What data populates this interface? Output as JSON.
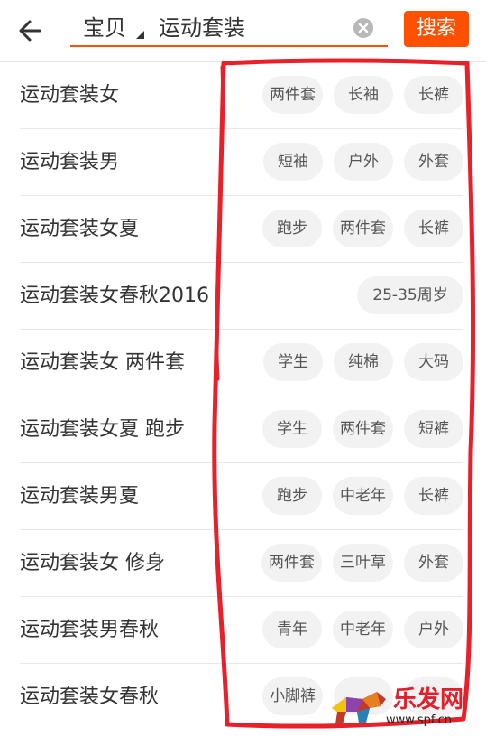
{
  "header": {
    "back_icon": "arrow-left-icon",
    "scope_label": "宝贝",
    "query": "运动套装",
    "clear_icon": "close-circle-icon",
    "search_button_label": "搜索"
  },
  "colors": {
    "accent": "#ff5000",
    "tag_background": "#f2f2f2",
    "annotation": "#e8202a"
  },
  "suggestions": [
    {
      "title": "运动套装女",
      "tags": [
        "两件套",
        "长袖",
        "长裤"
      ]
    },
    {
      "title": "运动套装男",
      "tags": [
        "短袖",
        "户外",
        "外套"
      ]
    },
    {
      "title": "运动套装女夏",
      "tags": [
        "跑步",
        "两件套",
        "长裤"
      ]
    },
    {
      "title": "运动套装女春秋2016",
      "tags": [
        "25-35周岁"
      ]
    },
    {
      "title": "运动套装女 两件套",
      "tags": [
        "学生",
        "纯棉",
        "大码"
      ]
    },
    {
      "title": "运动套装女夏 跑步",
      "tags": [
        "学生",
        "两件套",
        "短裤"
      ]
    },
    {
      "title": "运动套装男夏",
      "tags": [
        "跑步",
        "中老年",
        "长裤"
      ]
    },
    {
      "title": "运动套装女 修身",
      "tags": [
        "两件套",
        "三叶草",
        "外套"
      ]
    },
    {
      "title": "运动套装男春秋",
      "tags": [
        "青年",
        "中老年",
        "户外"
      ]
    },
    {
      "title": "运动套装女春秋",
      "tags": [
        "小脚裤",
        "",
        ""
      ]
    }
  ],
  "watermark": {
    "brand": "乐发网",
    "url": "www.spf.cn"
  }
}
